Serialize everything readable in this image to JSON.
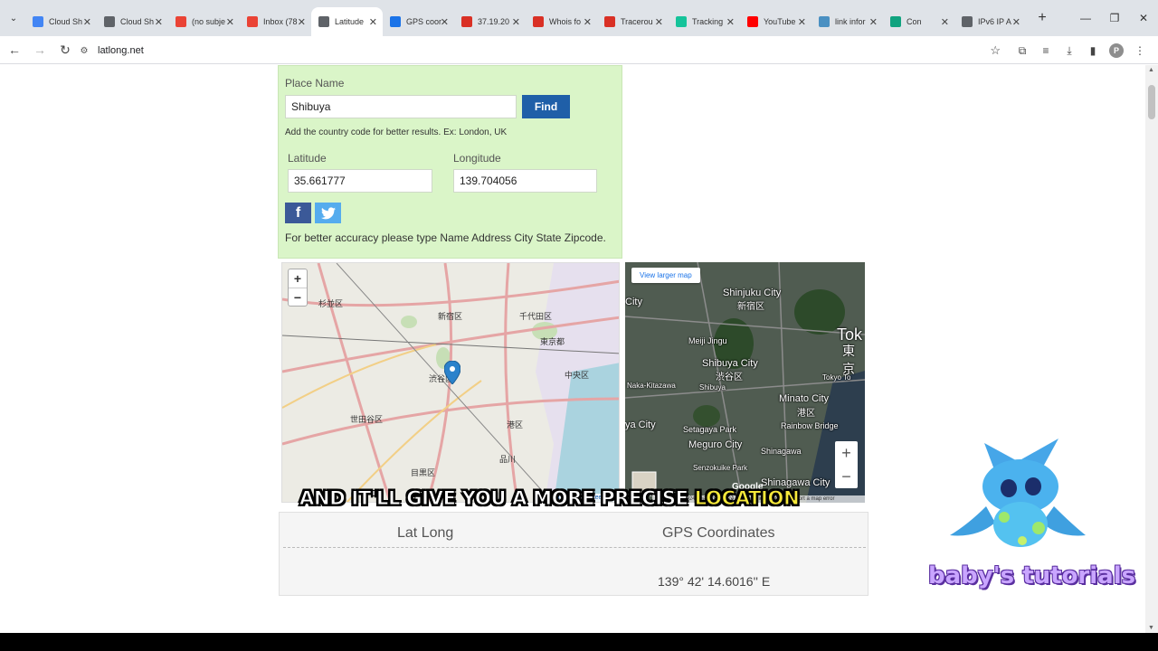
{
  "browser": {
    "tabs": [
      {
        "label": "Cloud Sh",
        "icon": "google-cloud-icon",
        "color": "#4285f4"
      },
      {
        "label": "Cloud Sh",
        "icon": "cloud-shell-icon",
        "color": "#5f6368"
      },
      {
        "label": "(no subje",
        "icon": "gmail-icon",
        "color": "#ea4335"
      },
      {
        "label": "Inbox (78",
        "icon": "gmail-icon",
        "color": "#ea4335"
      },
      {
        "label": "Latitude",
        "icon": "compass-icon",
        "color": "#5f6368"
      },
      {
        "label": "GPS coor",
        "icon": "shield-icon",
        "color": "#1a73e8"
      },
      {
        "label": "37.19.20",
        "icon": "ip-icon",
        "color": "#d93025"
      },
      {
        "label": "Whois fo",
        "icon": "ip-icon",
        "color": "#d93025"
      },
      {
        "label": "Tracerou",
        "icon": "ip-icon",
        "color": "#d93025"
      },
      {
        "label": "Tracking",
        "icon": "grammarly-icon",
        "color": "#15c39a"
      },
      {
        "label": "YouTube",
        "icon": "youtube-icon",
        "color": "#ff0000"
      },
      {
        "label": "link infor",
        "icon": "link-icon",
        "color": "#4a90c2"
      },
      {
        "label": "Con",
        "icon": "chatgpt-icon",
        "color": "#10a37f"
      },
      {
        "label": "IPv6 IP A",
        "icon": "ipv6-icon",
        "color": "#5f6368"
      }
    ],
    "active_tab_index": 4,
    "url": "latlong.net"
  },
  "form": {
    "place_name_label": "Place Name",
    "place_name_value": "Shibuya",
    "find_label": "Find",
    "hint": "Add the country code for better results. Ex: London, UK",
    "latitude_label": "Latitude",
    "latitude_value": "35.661777",
    "longitude_label": "Longitude",
    "longitude_value": "139.704056",
    "facebook_glyph": "f",
    "accuracy_note": "For better accuracy please type Name Address City State Zipcode."
  },
  "map_left": {
    "zoom_in": "+",
    "zoom_out": "−",
    "attribution_leaflet": "Leaflet",
    "attribution_sep": " | © ",
    "attribution_osm": "OpenStreetMap",
    "labels": [
      "杉並区",
      "新宿区",
      "千代田区",
      "東京都",
      "渋谷区",
      "中央区",
      "世田谷区",
      "港区",
      "目黒区",
      "品川"
    ]
  },
  "map_right": {
    "view_larger": "View larger map",
    "zoom_in": "+",
    "zoom_out": "−",
    "google": "Google",
    "attribution": "Map data ©2024 Imagery ©2024 TerraMetrics  |  Terms  |  Report a map error",
    "labels": [
      "Shinjuku City",
      "新宿区",
      "Meiji Jingu",
      "Shibuya City",
      "渋谷区",
      "Minato City",
      "港区",
      "Rainbow Bridge",
      "Setagaya Park",
      "Meguro City",
      "Senzokuike Park",
      "Shinagawa",
      "Shinagawa City",
      "Tok",
      "東京",
      "Tokyo To",
      "Naka-Kitazawa",
      "Shibuya",
      "ya City",
      "City"
    ]
  },
  "results": {
    "col1": "Lat Long",
    "col2": "GPS Coordinates",
    "gps_value": "139° 42' 14.6016'' E"
  },
  "overlay": {
    "caption_main": "AND IT'LL GIVE YOU A MORE PRECISE ",
    "caption_highlight": "LOCATION",
    "brand": "baby's tutorials"
  }
}
